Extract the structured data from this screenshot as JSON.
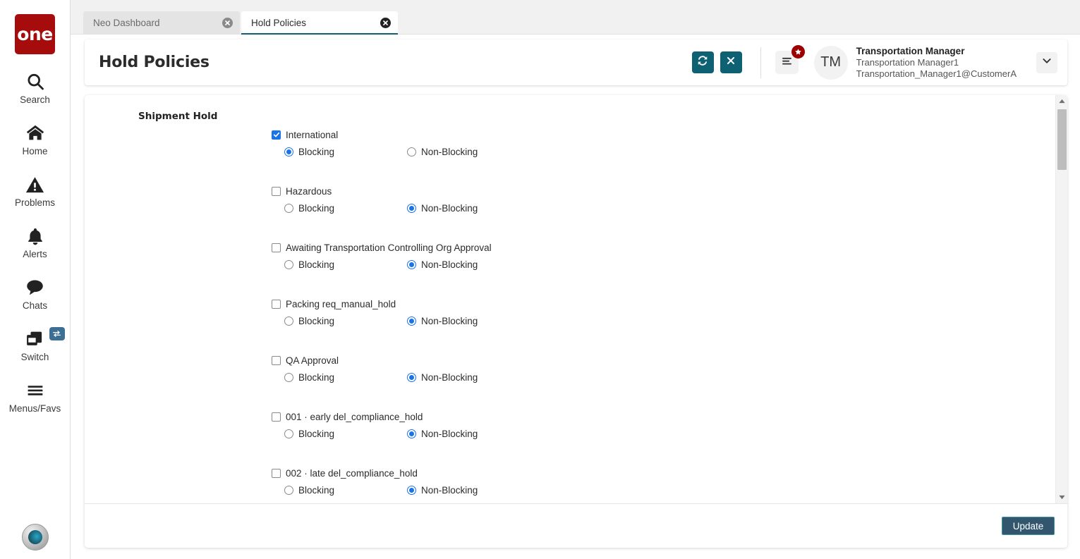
{
  "brand": {
    "logo_text": "one",
    "logo_color": "#a60c0c"
  },
  "rail": {
    "items": [
      {
        "label": "Search",
        "icon": "search-icon"
      },
      {
        "label": "Home",
        "icon": "home-icon"
      },
      {
        "label": "Problems",
        "icon": "warning-triangle-icon"
      },
      {
        "label": "Alerts",
        "icon": "bell-icon"
      },
      {
        "label": "Chats",
        "icon": "chat-bubble-icon"
      },
      {
        "label": "Switch",
        "icon": "switch-windows-icon",
        "badge_icon": "swap-arrows-icon"
      },
      {
        "label": "Menus/Favs",
        "icon": "hamburger-icon"
      }
    ]
  },
  "tabs": [
    {
      "label": "Neo Dashboard",
      "active": false
    },
    {
      "label": "Hold Policies",
      "active": true
    }
  ],
  "header": {
    "title": "Hold Policies",
    "refresh_icon": "refresh-icon",
    "close_icon": "close-icon",
    "menu_icon": "menu-list-icon",
    "menu_badge_icon": "star-icon",
    "avatar_initials": "TM",
    "user_role": "Transportation Manager",
    "user_name": "Transportation Manager1",
    "user_account": "Transportation_Manager1@CustomerA",
    "chevron_icon": "chevron-down-icon",
    "accent_color": "#0e6073",
    "badge_color": "#9c0000"
  },
  "content": {
    "section_label": "Shipment Hold",
    "option_blocking": "Blocking",
    "option_non_blocking": "Non-Blocking",
    "holds": [
      {
        "label": "International",
        "checked": true,
        "mode": "Blocking"
      },
      {
        "label": "Hazardous",
        "checked": false,
        "mode": "Non-Blocking"
      },
      {
        "label": "Awaiting Transportation Controlling Org Approval",
        "checked": false,
        "mode": "Non-Blocking"
      },
      {
        "label": "Packing req_manual_hold",
        "checked": false,
        "mode": "Non-Blocking"
      },
      {
        "label": "QA Approval",
        "checked": false,
        "mode": "Non-Blocking"
      },
      {
        "label": "001 · early del_compliance_hold",
        "checked": false,
        "mode": "Non-Blocking"
      },
      {
        "label": "002 · late del_compliance_hold",
        "checked": false,
        "mode": "Non-Blocking"
      }
    ]
  },
  "footer": {
    "update_label": "Update"
  }
}
